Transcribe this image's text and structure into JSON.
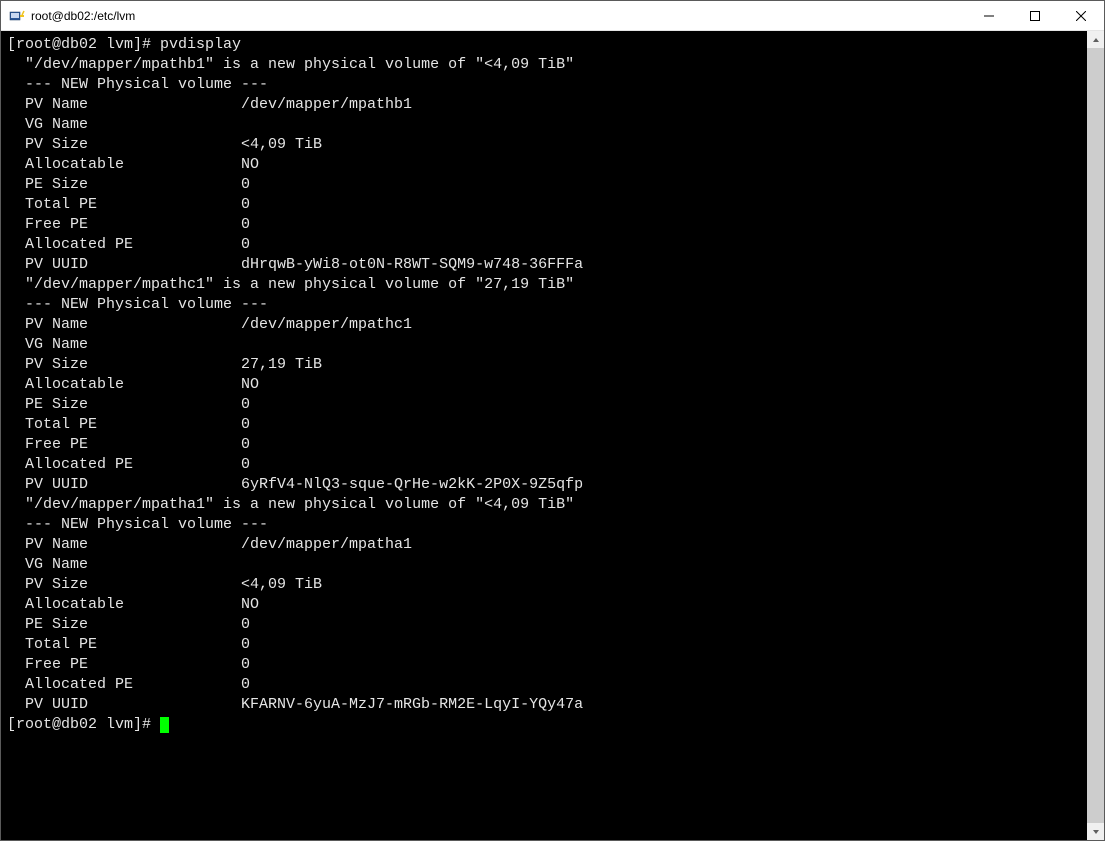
{
  "window": {
    "title": "root@db02:/etc/lvm"
  },
  "prompt": {
    "text": "[root@db02 lvm]# ",
    "command": "pvdisplay"
  },
  "volumes": [
    {
      "intro": "  \"/dev/mapper/mpathb1\" is a new physical volume of \"<4,09 TiB\"",
      "header": "  --- NEW Physical volume ---",
      "fields": [
        {
          "key": "  PV Name",
          "val": "/dev/mapper/mpathb1"
        },
        {
          "key": "  VG Name",
          "val": ""
        },
        {
          "key": "  PV Size",
          "val": "<4,09 TiB"
        },
        {
          "key": "  Allocatable",
          "val": "NO"
        },
        {
          "key": "  PE Size",
          "val": "0"
        },
        {
          "key": "  Total PE",
          "val": "0"
        },
        {
          "key": "  Free PE",
          "val": "0"
        },
        {
          "key": "  Allocated PE",
          "val": "0"
        },
        {
          "key": "  PV UUID",
          "val": "dHrqwB-yWi8-ot0N-R8WT-SQM9-w748-36FFFa"
        }
      ]
    },
    {
      "intro": "  \"/dev/mapper/mpathc1\" is a new physical volume of \"27,19 TiB\"",
      "header": "  --- NEW Physical volume ---",
      "fields": [
        {
          "key": "  PV Name",
          "val": "/dev/mapper/mpathc1"
        },
        {
          "key": "  VG Name",
          "val": ""
        },
        {
          "key": "  PV Size",
          "val": "27,19 TiB"
        },
        {
          "key": "  Allocatable",
          "val": "NO"
        },
        {
          "key": "  PE Size",
          "val": "0"
        },
        {
          "key": "  Total PE",
          "val": "0"
        },
        {
          "key": "  Free PE",
          "val": "0"
        },
        {
          "key": "  Allocated PE",
          "val": "0"
        },
        {
          "key": "  PV UUID",
          "val": "6yRfV4-NlQ3-sque-QrHe-w2kK-2P0X-9Z5qfp"
        }
      ]
    },
    {
      "intro": "  \"/dev/mapper/mpatha1\" is a new physical volume of \"<4,09 TiB\"",
      "header": "  --- NEW Physical volume ---",
      "fields": [
        {
          "key": "  PV Name",
          "val": "/dev/mapper/mpatha1"
        },
        {
          "key": "  VG Name",
          "val": ""
        },
        {
          "key": "  PV Size",
          "val": "<4,09 TiB"
        },
        {
          "key": "  Allocatable",
          "val": "NO"
        },
        {
          "key": "  PE Size",
          "val": "0"
        },
        {
          "key": "  Total PE",
          "val": "0"
        },
        {
          "key": "  Free PE",
          "val": "0"
        },
        {
          "key": "  Allocated PE",
          "val": "0"
        },
        {
          "key": "  PV UUID",
          "val": "KFARNV-6yuA-MzJ7-mRGb-RM2E-LqyI-YQy47a"
        }
      ]
    }
  ],
  "final_prompt": "[root@db02 lvm]# "
}
